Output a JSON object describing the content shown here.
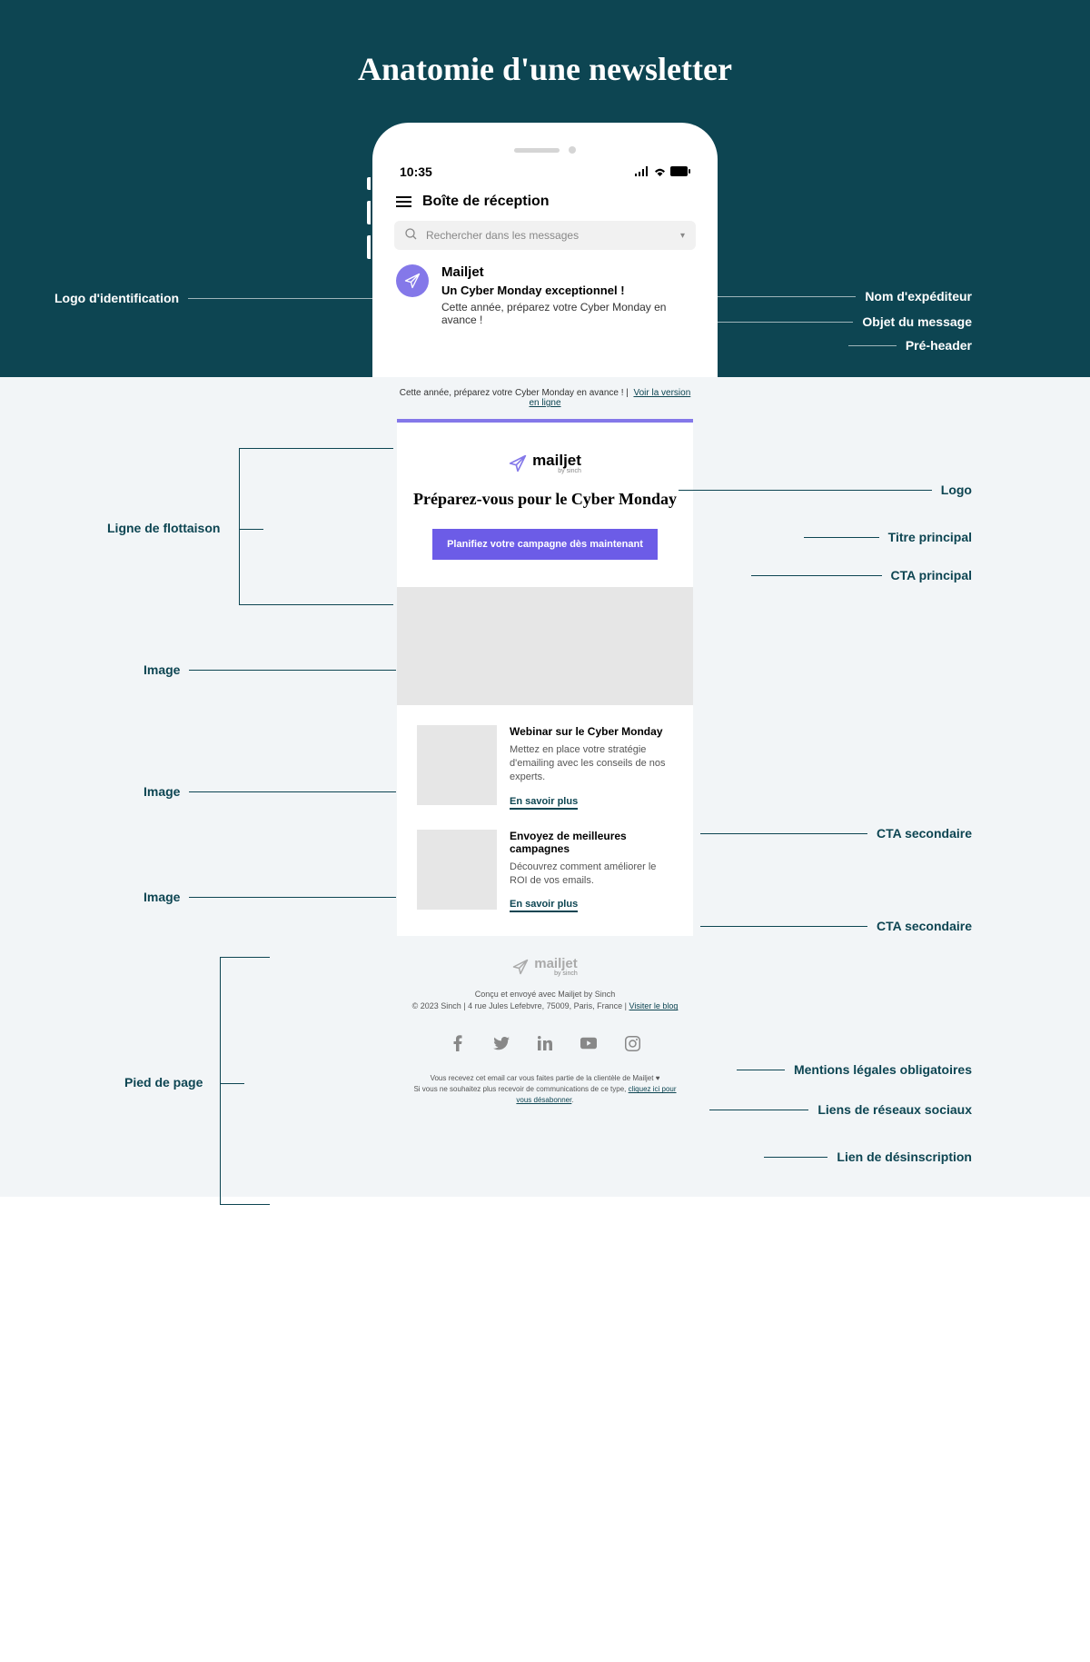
{
  "page_title": "Anatomie d'une newsletter",
  "phone": {
    "time": "10:35",
    "inbox_title": "Boîte de réception",
    "search_placeholder": "Rechercher dans les messages"
  },
  "email": {
    "sender": "Mailjet",
    "subject": "Un Cyber Monday exceptionnel !",
    "preheader": "Cette année, préparez votre Cyber Monday en avance !"
  },
  "annotations_top": {
    "logo_id": "Logo d'identification",
    "sender_name": "Nom d'expéditeur",
    "subject_label": "Objet du message",
    "preheader_label": "Pré-header"
  },
  "newsletter": {
    "top_text": "Cette année, préparez votre Cyber Monday en avance ! |",
    "view_online": "Voir la version en ligne",
    "logo_txt": "mailjet",
    "logo_by": "by sinch",
    "h1": "Préparez-vous pour le Cyber Monday",
    "cta": "Planifiez votre campagne dès maintenant",
    "article1": {
      "title": "Webinar sur le Cyber Monday",
      "text": "Mettez en place votre stratégie d'emailing avec les conseils de nos experts.",
      "link": "En savoir plus"
    },
    "article2": {
      "title": "Envoyez de meilleures campagnes",
      "text": "Découvrez comment améliorer le ROI de vos emails.",
      "link": "En savoir plus"
    },
    "footer": {
      "line1": "Conçu et envoyé avec Mailjet by Sinch",
      "line2_prefix": "© 2023 Sinch | 4 rue Jules Lefebvre, 75009, Paris, France |",
      "line2_link": "Visiter le blog",
      "unsub1": "Vous recevez cet email car vous faites partie de la clientèle de Mailjet ♥",
      "unsub2_prefix": "Si vous ne souhaitez plus recevoir de communications de ce type,",
      "unsub2_link": "cliquez ici pour vous désabonner"
    }
  },
  "annotations_bottom": {
    "fold": "Ligne de flottaison",
    "logo": "Logo",
    "title": "Titre principal",
    "cta_primary": "CTA principal",
    "image": "Image",
    "cta_secondary": "CTA secondaire",
    "footer_label": "Pied de page",
    "legal": "Mentions légales obligatoires",
    "social": "Liens de réseaux sociaux",
    "unsub": "Lien de désinscription"
  }
}
